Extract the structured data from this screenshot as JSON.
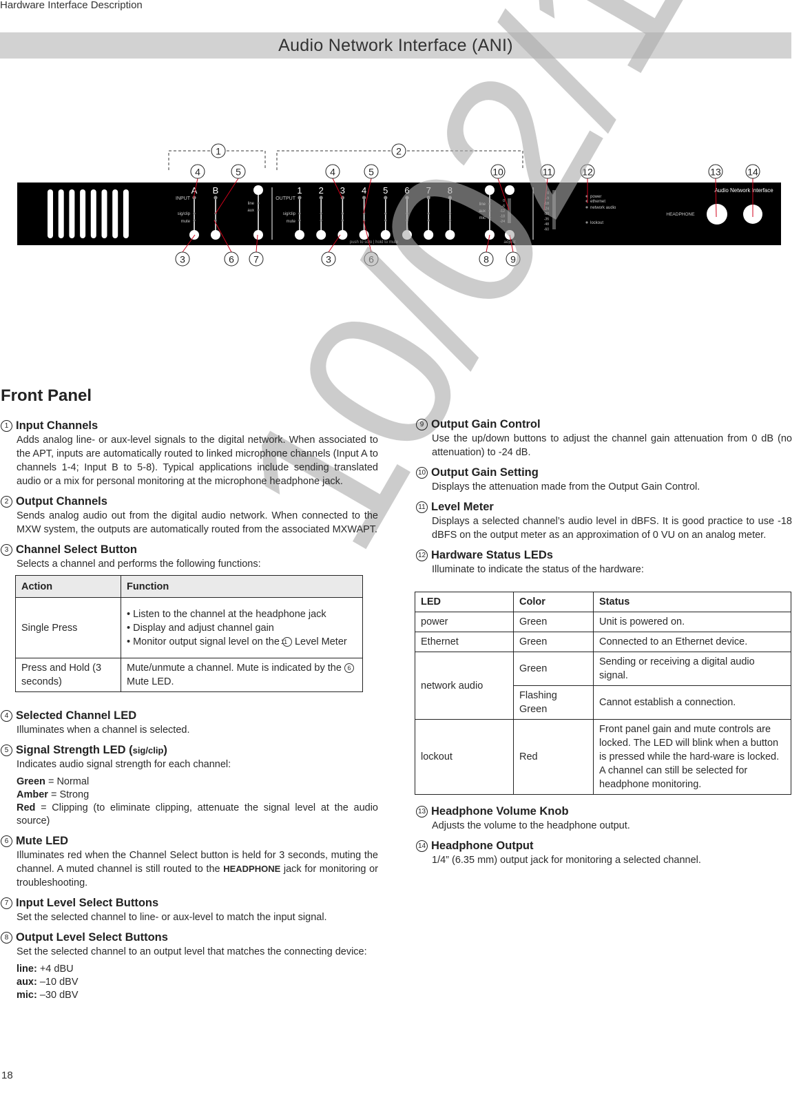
{
  "header": {
    "running_title": "Hardware Interface Description",
    "title": "Audio Network Interface (ANI)"
  },
  "diagram": {
    "brand_label": "Audio Network Interface",
    "input_label": "INPUT",
    "output_label": "OUTPUT",
    "sigclip_label": "sig/clip",
    "mute_label": "mute",
    "input_channels": [
      "A",
      "B"
    ],
    "output_channels": [
      "1",
      "2",
      "3",
      "4",
      "5",
      "6",
      "7",
      "8"
    ],
    "input_level_options": [
      "line",
      "aux"
    ],
    "output_level_options": [
      "line",
      "aux",
      "mic"
    ],
    "gain_scale": [
      "0",
      "-6",
      "-12",
      "-18",
      "-24"
    ],
    "meter_scale": [
      "0",
      "-9",
      "-18",
      "-24",
      "-30",
      "-36",
      "-48",
      "-60"
    ],
    "status_leds": [
      "power",
      "ethernet",
      "network audio",
      "lockout"
    ],
    "push_hint": "push to solo | hold to mute",
    "adjust_label": "adjust",
    "headphone_label": "HEADPHONE",
    "callouts": [
      "1",
      "2",
      "3",
      "4",
      "5",
      "6",
      "7",
      "8",
      "9",
      "10",
      "11",
      "12",
      "13",
      "14"
    ]
  },
  "section_title": "Front Panel",
  "items": {
    "i1": {
      "num": "1",
      "title": "Input Channels",
      "body": "Adds analog line- or aux-level signals to the digital network. When associated to the APT, inputs are automatically routed to linked microphone channels (Input A to channels 1-4; Input B to 5-8). Typical applications include sending translated audio or a mix for personal monitoring at the microphone headphone jack."
    },
    "i2": {
      "num": "2",
      "title": "Output Channels",
      "body": "Sends analog audio out from the digital audio network. When connected to the MXW system, the outputs are automatically routed from the associated MXWAPT."
    },
    "i3": {
      "num": "3",
      "title": "Channel Select Button",
      "body": "Selects a channel and performs the following functions:"
    },
    "i4": {
      "num": "4",
      "title": "Selected Channel LED",
      "body": "Illuminates when a channel is selected."
    },
    "i5": {
      "num": "5",
      "title": "Signal Strength LED (",
      "title_tag": "sig/clip",
      "title_end": ")",
      "body": "Indicates audio signal strength for each channel:",
      "levels": [
        {
          "key": "Green",
          "value": " = Normal"
        },
        {
          "key": "Amber",
          "value": " = Strong"
        },
        {
          "key": "Red",
          "value": " = Clipping (to eliminate clipping, attenuate the signal level at the audio source)"
        }
      ]
    },
    "i6": {
      "num": "6",
      "title": "Mute LED",
      "body_pre": "Illuminates red when the Channel Select button is held for 3 seconds, muting the channel. A muted channel is still routed to the ",
      "body_tag": "HEADPHONE",
      "body_post": " jack for monitoring or troubleshooting."
    },
    "i7": {
      "num": "7",
      "title": "Input Level Select Buttons",
      "body": "Set the selected channel to line- or aux-level to match the input signal."
    },
    "i8": {
      "num": "8",
      "title": "Output Level Select Buttons",
      "body": "Set the selected channel to an output level that matches the connecting device:",
      "levels": [
        {
          "key": "line:",
          "value": " +4 dBU"
        },
        {
          "key": "aux:",
          "value": " –10 dBV"
        },
        {
          "key": "mic:",
          "value": " –30 dBV"
        }
      ]
    },
    "i9": {
      "num": "9",
      "title": "Output Gain Control",
      "body": "Use the up/down buttons to adjust the channel gain attenuation from 0 dB (no attenuation) to -24 dB."
    },
    "i10": {
      "num": "10",
      "title": "Output Gain Setting",
      "body": "Displays the attenuation made from the Output Gain Control."
    },
    "i11": {
      "num": "11",
      "title": "Level Meter",
      "body": "Displays a selected channel’s audio level in dBFS. It is good practice to use -18 dBFS on the output meter as an approximation of 0 VU on an analog meter."
    },
    "i12": {
      "num": "12",
      "title": "Hardware Status LEDs",
      "body": "Illuminate to indicate the status of the hardware:"
    },
    "i13": {
      "num": "13",
      "title": "Headphone Volume Knob",
      "body": "Adjusts the volume to the headphone output."
    },
    "i14": {
      "num": "14",
      "title": "Headphone Output",
      "body": "1/4” (6.35 mm) output jack for monitoring a selected channel."
    }
  },
  "action_table": {
    "headers": [
      "Action",
      "Function"
    ],
    "row1": {
      "action": "Single Press",
      "bullets": [
        "• Listen to the channel at the headphone jack",
        "• Display and adjust channel gain",
        "• Monitor output signal level on the"
      ],
      "bullet3_num": "11",
      "bullet3_end": " Level Meter"
    },
    "row2": {
      "action": "Press and Hold (3 seconds)",
      "func_pre": "Mute/unmute a channel. Mute is indicated by the ",
      "func_num": "6",
      "func_post": " Mute LED."
    }
  },
  "led_table": {
    "headers": [
      "LED",
      "Color",
      "Status"
    ],
    "rows": [
      {
        "led": "power",
        "color": "Green",
        "status": "Unit is powered on."
      },
      {
        "led": "Ethernet",
        "color": "Green",
        "status": "Connected to an Ethernet device."
      },
      {
        "led": "network audio",
        "color": "Green",
        "status": "Sending or receiving a digital audio signal."
      },
      {
        "led": "",
        "color": "Flashing Green",
        "status": "Cannot establish a connection."
      },
      {
        "led": "lockout",
        "color": "Red",
        "status": "Front panel gain and mute controls are locked. The LED will blink when a button is pressed while the hard-ware is locked. A channel can still be selected for headphone monitoring."
      }
    ]
  },
  "watermark": "10/02/12",
  "page_number": "18"
}
